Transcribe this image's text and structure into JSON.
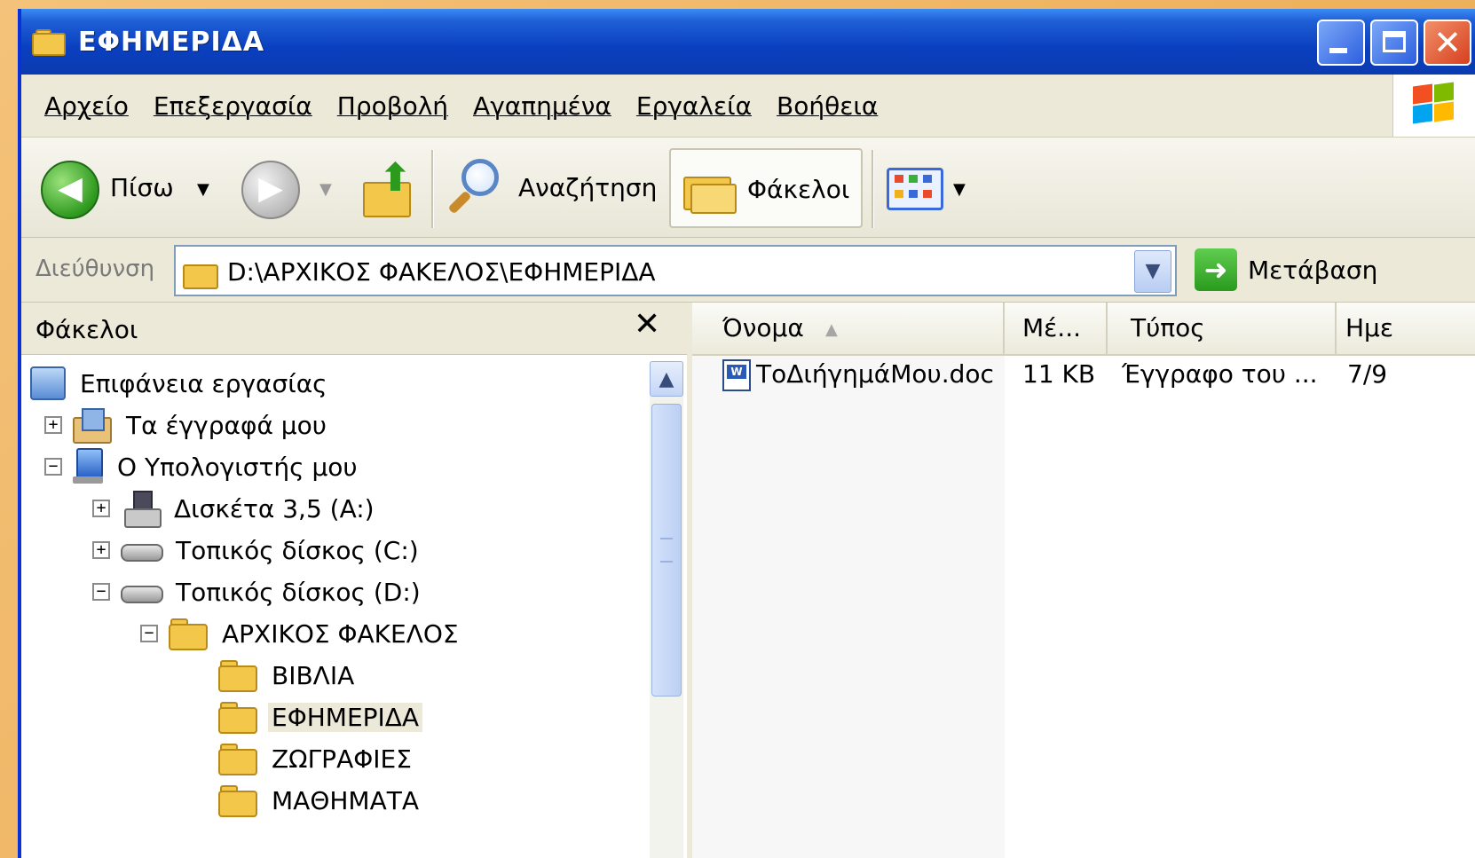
{
  "window": {
    "title": "ΕΦΗΜΕΡΙΔΑ"
  },
  "menu": {
    "items": [
      "Αρχείο",
      "Επεξεργασία",
      "Προβολή",
      "Αγαπημένα",
      "Εργαλεία",
      "Βοήθεια"
    ]
  },
  "toolbar": {
    "back_label": "Πίσω",
    "search_label": "Αναζήτηση",
    "folders_label": "Φάκελοι"
  },
  "address": {
    "label": "Διεύθυνση",
    "value": "D:\\ΑΡΧΙΚΟΣ ΦΑΚΕΛΟΣ\\ΕΦΗΜΕΡΙΔΑ",
    "go_label": "Μετάβαση"
  },
  "folders_pane": {
    "title": "Φάκελοι",
    "close_glyph": "✕",
    "tree": [
      {
        "label": "Επιφάνεια εργασίας",
        "icon": "desktop-icon",
        "expander": ""
      },
      {
        "label": "Τα έγγραφά μου",
        "icon": "my-documents-icon",
        "expander": "+"
      },
      {
        "label": "Ο Υπολογιστής μου",
        "icon": "my-computer-icon",
        "expander": "−"
      },
      {
        "label": "Δισκέτα 3,5 (A:)",
        "icon": "floppy-drive-icon",
        "expander": "+"
      },
      {
        "label": "Τοπικός δίσκος (C:)",
        "icon": "hard-disk-icon",
        "expander": "+"
      },
      {
        "label": "Τοπικός δίσκος (D:)",
        "icon": "hard-disk-icon",
        "expander": "−"
      },
      {
        "label": "ΑΡΧΙΚΟΣ ΦΑΚΕΛΟΣ",
        "icon": "folder-icon",
        "expander": "−"
      },
      {
        "label": "ΒΙΒΛΙΑ",
        "icon": "folder-icon",
        "expander": ""
      },
      {
        "label": "ΕΦΗΜΕΡΙΔΑ",
        "icon": "folder-icon",
        "expander": "",
        "selected": true
      },
      {
        "label": "ΖΩΓΡΑΦΙΕΣ",
        "icon": "folder-icon",
        "expander": ""
      },
      {
        "label": "ΜΑΘΗΜΑΤΑ",
        "icon": "folder-icon",
        "expander": ""
      }
    ]
  },
  "file_list": {
    "columns": [
      "Όνομα",
      "Μέ...",
      "Τύπος",
      "Ημε"
    ],
    "rows": [
      {
        "name": "ΤοΔιήγημάΜου.doc",
        "size": "11 KB",
        "type": "Έγγραφο του ...",
        "date": "7/9"
      }
    ]
  },
  "colors": {
    "title_bar": "#0a3fbf",
    "window_face": "#ece9d8",
    "frame_border": "#f4c27a"
  }
}
